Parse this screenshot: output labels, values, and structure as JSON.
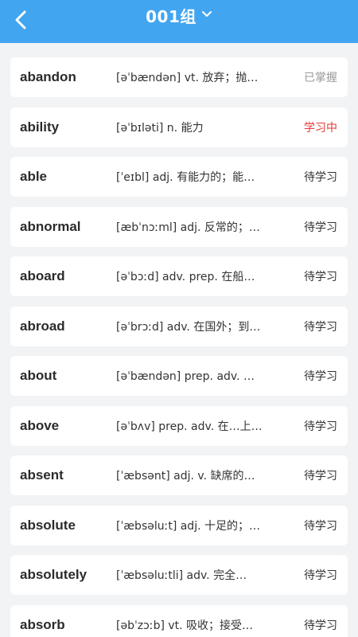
{
  "header": {
    "title": "001组",
    "back_icon": "chevron-left-icon",
    "dropdown_icon": "chevron-down-icon",
    "color": "#42a5f0"
  },
  "status_colors": {
    "mastered": "#9a9a9a",
    "learning": "#e53935",
    "pending": "#333333"
  },
  "words": [
    {
      "word": "abandon",
      "definition": "[əˈbændən] vt. 放弃；抛弃…",
      "status": "已掌握",
      "state": "mastered"
    },
    {
      "word": "ability",
      "definition": "[əˈbɪləti] n. 能力",
      "status": "学习中",
      "state": "learning"
    },
    {
      "word": "able",
      "definition": "[ˈeɪbl] adj. 有能力的；能…",
      "status": "待学习",
      "state": "pending"
    },
    {
      "word": "abnormal",
      "definition": "[æbˈnɔːml] adj. 反常的；…",
      "status": "待学习",
      "state": "pending"
    },
    {
      "word": "aboard",
      "definition": "[əˈbɔːd] adv.  prep. 在船（…",
      "status": "待学习",
      "state": "pending"
    },
    {
      "word": "abroad",
      "definition": "[əˈbrɔːd] adv. 在国外；到…",
      "status": "待学习",
      "state": "pending"
    },
    {
      "word": "about",
      "definition": "[əˈbændən] prep. adv. 关…",
      "status": "待学习",
      "state": "pending"
    },
    {
      "word": "above",
      "definition": "[əˈbʌv] prep. adv. 在…上面…",
      "status": "待学习",
      "state": "pending"
    },
    {
      "word": "absent",
      "definition": "[ˈæbsənt] adj.  v.  缺席的…",
      "status": "待学习",
      "state": "pending"
    },
    {
      "word": "absolute",
      "definition": "[ˈæbsəluːt] adj. 十足的；…",
      "status": "待学习",
      "state": "pending"
    },
    {
      "word": "absolutely",
      "definition": "[ˈæbsəluːtli] adv.  完全…",
      "status": "待学习",
      "state": "pending"
    },
    {
      "word": "absorb",
      "definition": "[əbˈzɔːb] vt. 吸收；接受；…",
      "status": "待学习",
      "state": "pending"
    }
  ]
}
